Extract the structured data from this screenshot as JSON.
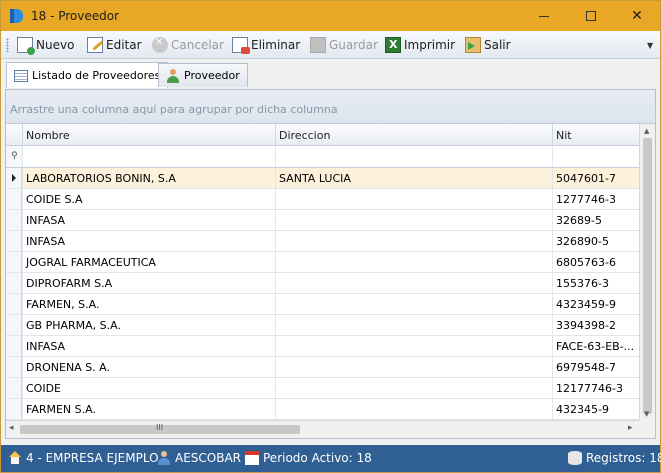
{
  "window": {
    "title": "18 - Proveedor"
  },
  "toolbar": {
    "nuevo": "Nuevo",
    "editar": "Editar",
    "cancelar": "Cancelar",
    "eliminar": "Eliminar",
    "guardar": "Guardar",
    "imprimir": "Imprimir",
    "salir": "Salir"
  },
  "tabs": [
    {
      "label": "Listado de Proveedores",
      "active": true
    },
    {
      "label": "Proveedor",
      "active": false
    }
  ],
  "grid": {
    "group_hint": "Arrastre una columna aquí para agrupar por dicha columna",
    "columns": [
      "Nombre",
      "Direccion",
      "Nit"
    ],
    "rows": [
      {
        "nombre": "LABORATORIOS BONIN, S.A",
        "direccion": "SANTA LUCIA",
        "nit": "5047601-7",
        "selected": true
      },
      {
        "nombre": "COIDE S.A",
        "direccion": "",
        "nit": "1277746-3"
      },
      {
        "nombre": "INFASA",
        "direccion": "",
        "nit": "32689-5"
      },
      {
        "nombre": "INFASA",
        "direccion": "",
        "nit": "326890-5"
      },
      {
        "nombre": "JOGRAL FARMACEUTICA",
        "direccion": "",
        "nit": "6805763-6"
      },
      {
        "nombre": "DIPROFARM S.A",
        "direccion": "",
        "nit": "155376-3"
      },
      {
        "nombre": "FARMEN, S.A.",
        "direccion": "",
        "nit": "4323459-9"
      },
      {
        "nombre": "GB PHARMA, S.A.",
        "direccion": "",
        "nit": "3394398-2"
      },
      {
        "nombre": "INFASA",
        "direccion": "",
        "nit": "FACE-63-EB-..."
      },
      {
        "nombre": "DRONENA S. A.",
        "direccion": "",
        "nit": "6979548-7"
      },
      {
        "nombre": "COIDE",
        "direccion": "",
        "nit": "12177746-3"
      },
      {
        "nombre": "FARMEN  S.A.",
        "direccion": "",
        "nit": "432345-9"
      }
    ]
  },
  "statusbar": {
    "empresa": "4 - EMPRESA EJEMPLO",
    "usuario": "AESCOBAR",
    "periodo": "Periodo Activo: 18",
    "registros": "Registros: 18"
  },
  "colors": {
    "titlebar": "#e8a826",
    "statusbar": "#2f5f93",
    "selected_row": "#fdf1dc"
  }
}
